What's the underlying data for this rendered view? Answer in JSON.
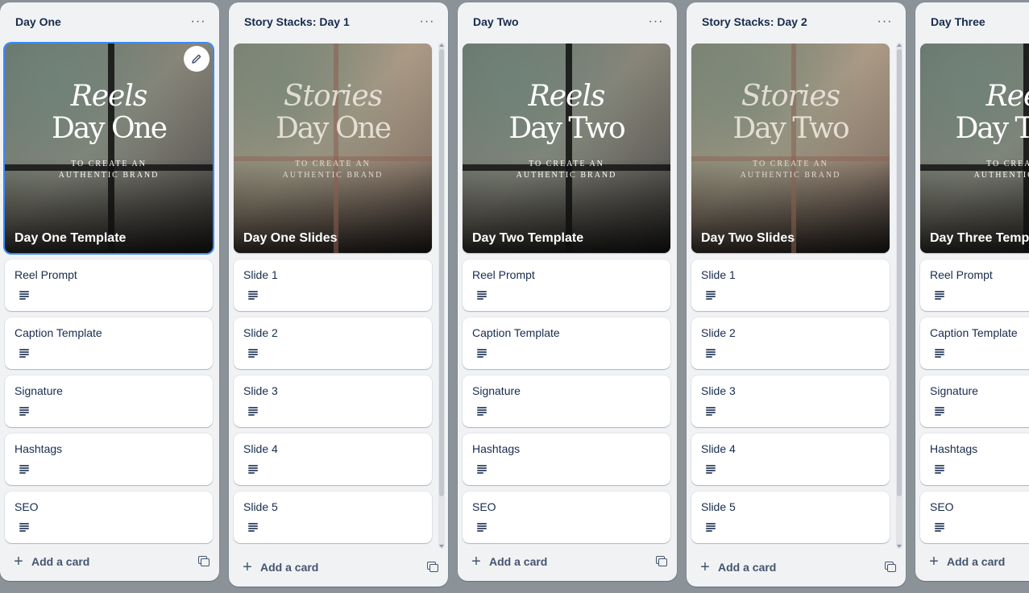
{
  "lists": [
    {
      "title": "Day One",
      "menu": "···",
      "cover": {
        "headline1": "Reels",
        "headline2": "Day One",
        "sub1": "TO CREATE AN",
        "sub2": "AUTHENTIC BRAND",
        "title": "Day One Template"
      },
      "cards": [
        "Reel Prompt",
        "Caption Template",
        "Signature",
        "Hashtags",
        "SEO"
      ],
      "add_label": "Add a card"
    },
    {
      "title": "Story Stacks: Day 1",
      "menu": "···",
      "cover": {
        "headline1": "Stories",
        "headline2": "Day One",
        "sub1": "TO CREATE AN",
        "sub2": "AUTHENTIC BRAND",
        "title": "Day One Slides"
      },
      "cards": [
        "Slide 1",
        "Slide 2",
        "Slide 3",
        "Slide 4",
        "Slide 5"
      ],
      "add_label": "Add a card"
    },
    {
      "title": "Day Two",
      "menu": "···",
      "cover": {
        "headline1": "Reels",
        "headline2": "Day Two",
        "sub1": "TO CREATE AN",
        "sub2": "AUTHENTIC BRAND",
        "title": "Day Two Template"
      },
      "cards": [
        "Reel Prompt",
        "Caption Template",
        "Signature",
        "Hashtags",
        "SEO"
      ],
      "add_label": "Add a card"
    },
    {
      "title": "Story Stacks: Day 2",
      "menu": "···",
      "cover": {
        "headline1": "Stories",
        "headline2": "Day Two",
        "sub1": "TO CREATE AN",
        "sub2": "AUTHENTIC BRAND",
        "title": "Day Two Slides"
      },
      "cards": [
        "Slide 1",
        "Slide 2",
        "Slide 3",
        "Slide 4",
        "Slide 5"
      ],
      "add_label": "Add a card"
    },
    {
      "title": "Day Three",
      "cover": {
        "headline1": "Reels",
        "headline2": "Day Three",
        "sub1": "TO CREATE AN",
        "sub2": "AUTHENTIC BRAND",
        "title": "Day Three Template"
      },
      "cards": [
        "Reel Prompt",
        "Caption Template",
        "Signature",
        "Hashtags",
        "SEO"
      ],
      "add_label": "Add a card"
    }
  ],
  "icons": {
    "list_menu": "more-horizontal-icon",
    "edit": "pencil-icon",
    "description": "description-icon",
    "add": "plus-icon",
    "template": "card-template-icon"
  },
  "colors": {
    "board_background": "#8b9399",
    "list_background": "#f1f2f4",
    "card_background": "#ffffff",
    "text": "#172b4d",
    "selected_outline": "#388bff"
  }
}
